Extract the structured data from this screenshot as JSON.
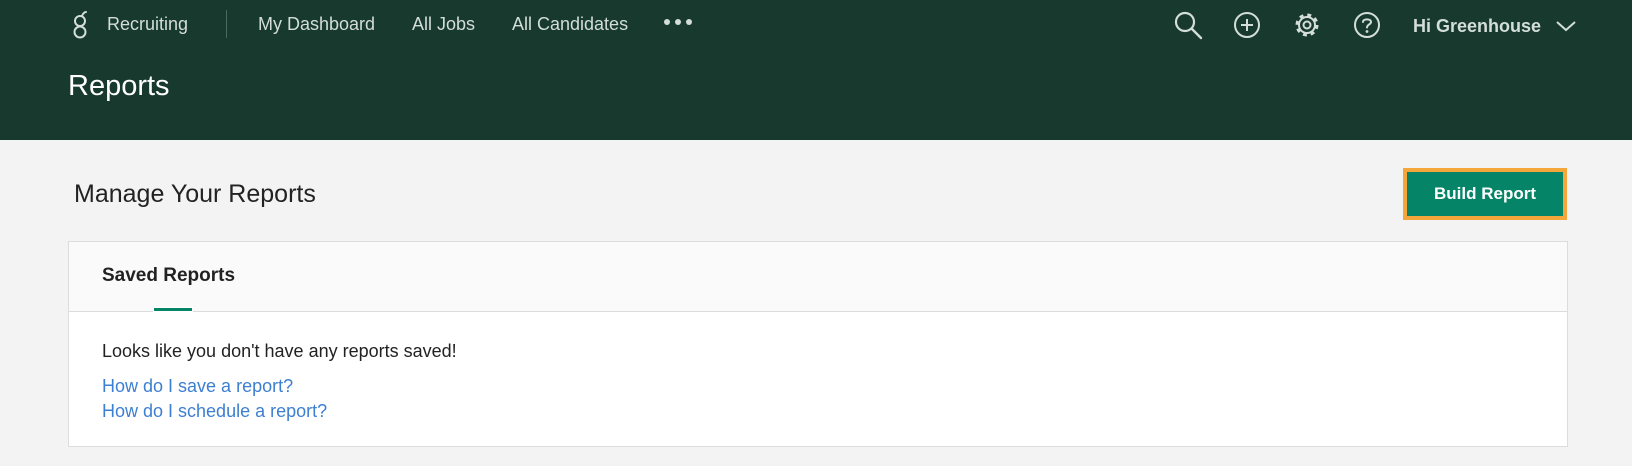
{
  "nav": {
    "product": "Recruiting",
    "items": [
      {
        "label": "My Dashboard"
      },
      {
        "label": "All Jobs"
      },
      {
        "label": "All Candidates"
      }
    ],
    "more_icon": "more-dots-icon",
    "icons": [
      "search-icon",
      "add-circle-icon",
      "gear-icon",
      "help-icon"
    ],
    "user_greeting": "Hi Greenhouse"
  },
  "header": {
    "page_title": "Reports"
  },
  "main": {
    "title": "Manage Your Reports",
    "build_button": "Build Report",
    "card": {
      "tab_label": "Saved Reports",
      "empty_message": "Looks like you don't have any reports saved!",
      "links": [
        {
          "label": "How do I save a report?"
        },
        {
          "label": "How do I schedule a report?"
        }
      ]
    }
  },
  "colors": {
    "header_bg": "#17392e",
    "accent": "#058468",
    "highlight": "#f4a63b",
    "link": "#3d7fd0",
    "page_bg": "#f3f3f3"
  }
}
